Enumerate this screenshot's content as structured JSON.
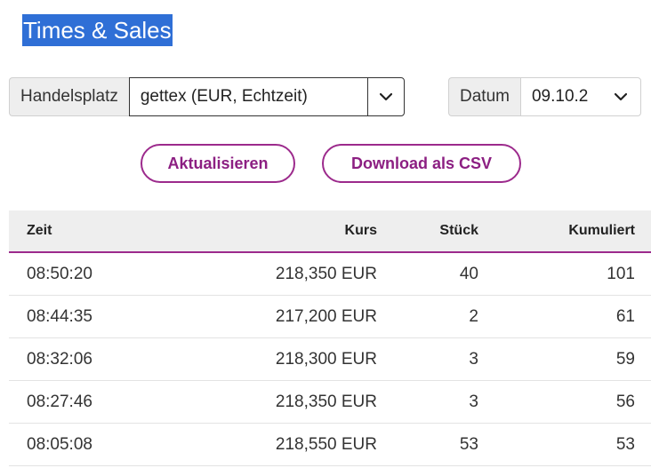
{
  "title": "Times & Sales",
  "controls": {
    "exchange": {
      "label": "Handelsplatz",
      "selected": "gettex (EUR, Echtzeit)"
    },
    "date": {
      "label": "Datum",
      "selected": "09.10.2"
    }
  },
  "buttons": {
    "refresh": "Aktualisieren",
    "download_csv": "Download als CSV"
  },
  "table": {
    "headers": {
      "time": "Zeit",
      "price": "Kurs",
      "pieces": "Stück",
      "cumulative": "Kumuliert"
    },
    "rows": [
      {
        "time": "08:50:20",
        "price": "218,350 EUR",
        "pieces": "40",
        "cumulative": "101"
      },
      {
        "time": "08:44:35",
        "price": "217,200 EUR",
        "pieces": "2",
        "cumulative": "61"
      },
      {
        "time": "08:32:06",
        "price": "218,300 EUR",
        "pieces": "3",
        "cumulative": "59"
      },
      {
        "time": "08:27:46",
        "price": "218,350 EUR",
        "pieces": "3",
        "cumulative": "56"
      },
      {
        "time": "08:05:08",
        "price": "218,550 EUR",
        "pieces": "53",
        "cumulative": "53"
      }
    ]
  },
  "colors": {
    "title_highlight": "#2f6fd6",
    "accent": "#9c2a8c",
    "header_bg": "#eeeeee"
  }
}
